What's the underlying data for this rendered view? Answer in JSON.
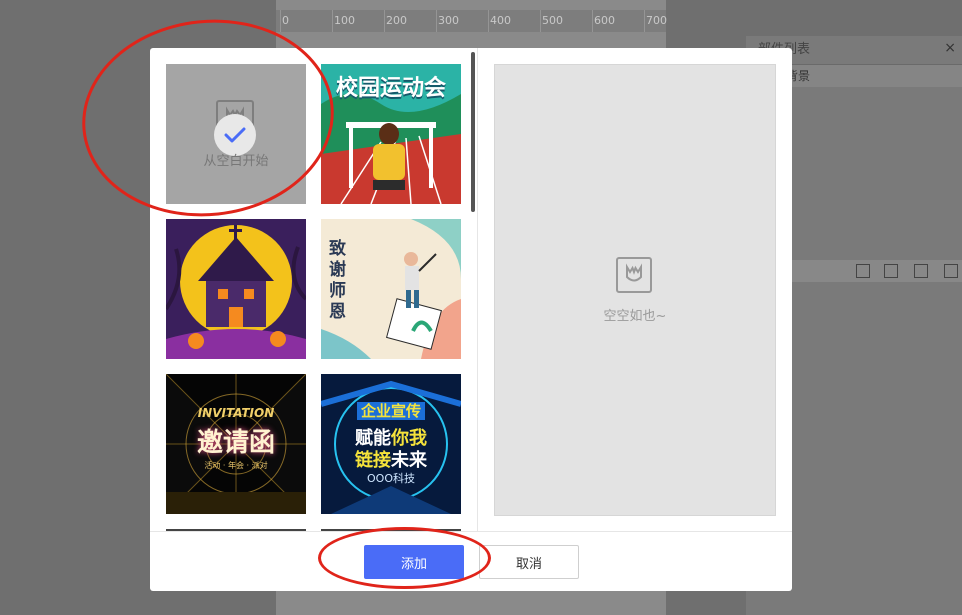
{
  "ruler": {
    "ticks": [
      "0",
      "100",
      "200",
      "300",
      "400",
      "500",
      "600",
      "700"
    ]
  },
  "right_panel": {
    "title": "部件列表",
    "layer_item": "背景",
    "close_glyph": "×"
  },
  "modal": {
    "blank_template_label": "从空白开始",
    "templates": [
      {
        "name": "blank",
        "label": "从空白开始"
      },
      {
        "name": "sports-meet",
        "title": "校园运动会"
      },
      {
        "name": "halloween",
        "title": ""
      },
      {
        "name": "teacher-day",
        "title": "致谢师恩"
      },
      {
        "name": "invitation",
        "title_en": "INVITATION",
        "title": "邀请函",
        "subtitle": "活动 · 年会 · 派对"
      },
      {
        "name": "corporate",
        "line1": "企业宣传",
        "line2a": "赋能",
        "line2b": "你我",
        "line3a": "链接",
        "line3b": "未来",
        "line4": "OOO科技"
      }
    ],
    "preview_empty_text": "空空如也~",
    "add_label": "添加",
    "cancel_label": "取消"
  },
  "colors": {
    "accent": "#4a6cf7",
    "annotation": "#e0241a"
  }
}
